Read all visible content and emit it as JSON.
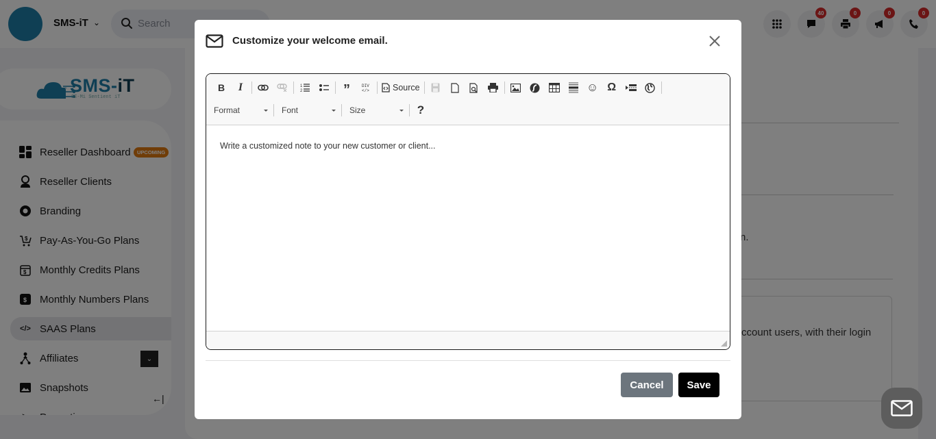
{
  "topbar": {
    "brand_name": "SMS-iT",
    "search_placeholder": "Search",
    "icons": [
      {
        "name": "apps-grid-icon",
        "glyph": "⋮⋮⋮",
        "badge": null
      },
      {
        "name": "chat-icon",
        "glyph": "💬",
        "badge": "40"
      },
      {
        "name": "printer-icon",
        "glyph": "🖶",
        "badge": "0"
      },
      {
        "name": "megaphone-icon",
        "glyph": "📣",
        "badge": "0"
      },
      {
        "name": "phone-icon",
        "glyph": "📞",
        "badge": "0"
      }
    ],
    "badges": {
      "chat": "40",
      "printer": "0",
      "megaphone": "0",
      "phone": "0"
    }
  },
  "logo": {
    "text_main": "SMS-",
    "text_accent": "iT",
    "tagline": "SE-Mi Sentient iT"
  },
  "sidebar": {
    "items": [
      {
        "label": "Reseller Dashboard",
        "icon": "dashboard-icon",
        "badge": "UPCOMING"
      },
      {
        "label": "Reseller Clients",
        "icon": "clients-icon"
      },
      {
        "label": "Branding",
        "icon": "branding-icon"
      },
      {
        "label": "Pay-As-You-Go Plans",
        "icon": "cart-dollar-icon"
      },
      {
        "label": "Monthly Credits Plans",
        "icon": "calendar-dollar-icon"
      },
      {
        "label": "Monthly Numbers Plans",
        "icon": "dollar-square-icon"
      },
      {
        "label": "SAAS Plans",
        "icon": "code-icon",
        "active": true
      },
      {
        "label": "Affiliates",
        "icon": "affiliates-icon"
      },
      {
        "label": "Snapshots",
        "icon": "image-icon"
      },
      {
        "label": "Promotions",
        "icon": "promo-icon"
      }
    ],
    "collapse_glyph": "←|"
  },
  "background": {
    "text_fragment_1": "n.",
    "text_fragment_2": "ccount users, with their login"
  },
  "modal": {
    "title": "Customize your welcome email.",
    "editor": {
      "toolbar_row1": [
        {
          "name": "bold-button",
          "glyph": "B"
        },
        {
          "name": "italic-button",
          "glyph": "I"
        },
        {
          "name": "link-button",
          "glyph": "🔗"
        },
        {
          "name": "unlink-button",
          "glyph": "⛓",
          "disabled": true
        },
        {
          "name": "numbered-list-button",
          "glyph": "1≡"
        },
        {
          "name": "bulleted-list-button",
          "glyph": "•≡"
        },
        {
          "name": "blockquote-button",
          "glyph": "❞"
        },
        {
          "name": "create-div-button",
          "glyph": "DIV"
        },
        {
          "name": "source-button",
          "label": "Source"
        },
        {
          "name": "save-doc-button",
          "disabled": true
        },
        {
          "name": "new-page-button"
        },
        {
          "name": "preview-button"
        },
        {
          "name": "print-button"
        },
        {
          "name": "image-button"
        },
        {
          "name": "flash-button"
        },
        {
          "name": "table-button"
        },
        {
          "name": "horizontal-line-button"
        },
        {
          "name": "smiley-button",
          "glyph": "☺"
        },
        {
          "name": "special-char-button",
          "glyph": "Ω"
        },
        {
          "name": "page-break-button"
        },
        {
          "name": "iframe-button",
          "glyph": "🌐"
        }
      ],
      "source_label": "Source",
      "format_label": "Format",
      "font_label": "Font",
      "size_label": "Size",
      "help_glyph": "?",
      "content_text": "Write a customized note to your new customer or client..."
    },
    "cancel_label": "Cancel",
    "save_label": "Save"
  }
}
